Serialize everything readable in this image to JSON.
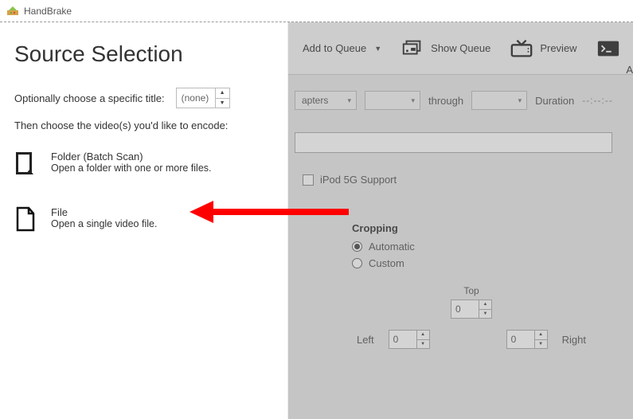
{
  "titlebar": {
    "app_name": "HandBrake"
  },
  "sidebar": {
    "heading": "Source Selection",
    "title_label": "Optionally choose a specific title:",
    "title_value": "(none)",
    "instruction": "Then choose the video(s) you'd like to encode:",
    "folder": {
      "title": "Folder (Batch Scan)",
      "desc": "Open a folder with one or more files."
    },
    "file": {
      "title": "File",
      "desc": "Open a single video file."
    }
  },
  "toolbar": {
    "add_queue": "Add to Queue",
    "show_queue": "Show Queue",
    "preview": "Preview",
    "edge": "A"
  },
  "main": {
    "chapters_label": "apters",
    "through": "through",
    "duration_label": "Duration",
    "duration_value": "--:--:--",
    "ipod": "iPod 5G Support",
    "cropping": {
      "heading": "Cropping",
      "auto": "Automatic",
      "custom": "Custom",
      "top": "Top",
      "left": "Left",
      "right": "Right",
      "val_top": "0",
      "val_left": "0",
      "val_right": "0"
    }
  }
}
